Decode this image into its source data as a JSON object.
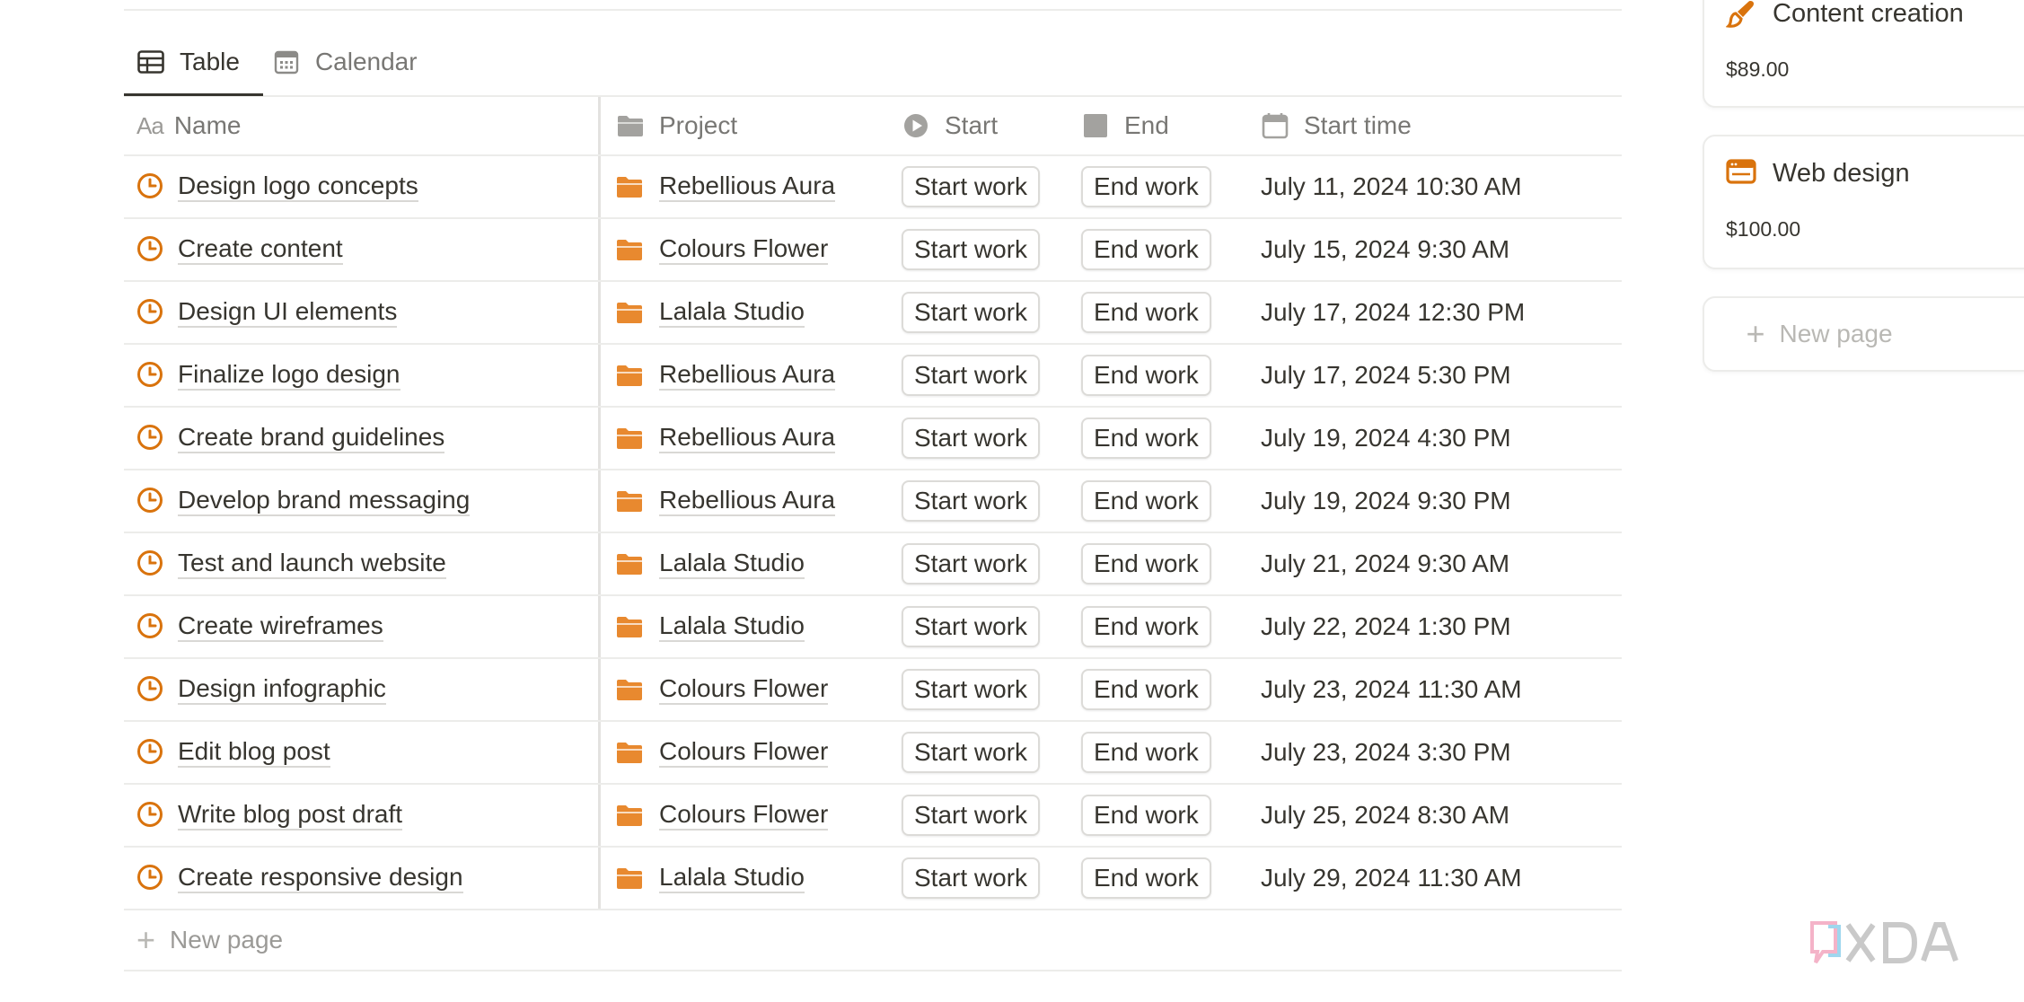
{
  "tabs": [
    {
      "label": "Table",
      "icon": "table-icon",
      "active": true
    },
    {
      "label": "Calendar",
      "icon": "calendar-icon",
      "active": false
    }
  ],
  "columns": {
    "name": {
      "label": "Name",
      "prefix": "Aa"
    },
    "project": {
      "label": "Project",
      "icon": "folder-icon"
    },
    "start": {
      "label": "Start",
      "icon": "play-circle-icon"
    },
    "end": {
      "label": "End",
      "icon": "stop-square-icon"
    },
    "start_time": {
      "label": "Start time",
      "icon": "calendar-icon"
    }
  },
  "rows": [
    {
      "name": "Design logo concepts",
      "project": "Rebellious Aura",
      "start": "Start work",
      "end": "End work",
      "start_time": "July 11, 2024 10:30 AM"
    },
    {
      "name": "Create content",
      "project": "Colours Flower",
      "start": "Start work",
      "end": "End work",
      "start_time": "July 15, 2024 9:30 AM"
    },
    {
      "name": "Design UI elements",
      "project": "Lalala Studio",
      "start": "Start work",
      "end": "End work",
      "start_time": "July 17, 2024 12:30 PM"
    },
    {
      "name": "Finalize logo design",
      "project": "Rebellious Aura",
      "start": "Start work",
      "end": "End work",
      "start_time": "July 17, 2024 5:30 PM"
    },
    {
      "name": "Create brand guidelines",
      "project": "Rebellious Aura",
      "start": "Start work",
      "end": "End work",
      "start_time": "July 19, 2024 4:30 PM"
    },
    {
      "name": "Develop brand messaging",
      "project": "Rebellious Aura",
      "start": "Start work",
      "end": "End work",
      "start_time": "July 19, 2024 9:30 PM"
    },
    {
      "name": "Test and launch website",
      "project": "Lalala Studio",
      "start": "Start work",
      "end": "End work",
      "start_time": "July 21, 2024 9:30 AM"
    },
    {
      "name": "Create wireframes",
      "project": "Lalala Studio",
      "start": "Start work",
      "end": "End work",
      "start_time": "July 22, 2024 1:30 PM"
    },
    {
      "name": "Design infographic",
      "project": "Colours Flower",
      "start": "Start work",
      "end": "End work",
      "start_time": "July 23, 2024 11:30 AM"
    },
    {
      "name": "Edit blog post",
      "project": "Colours Flower",
      "start": "Start work",
      "end": "End work",
      "start_time": "July 23, 2024 3:30 PM"
    },
    {
      "name": "Write blog post draft",
      "project": "Colours Flower",
      "start": "Start work",
      "end": "End work",
      "start_time": "July 25, 2024 8:30 AM"
    },
    {
      "name": "Create responsive design",
      "project": "Lalala Studio",
      "start": "Start work",
      "end": "End work",
      "start_time": "July 29, 2024 11:30 AM"
    }
  ],
  "table_new_page": "New page",
  "board": {
    "cards": [
      {
        "title": "Content creation",
        "price": "$89.00",
        "icon": "brush-icon"
      },
      {
        "title": "Web design",
        "price": "$100.00",
        "icon": "browser-window-icon"
      }
    ],
    "new_page": "New page"
  },
  "watermark": "XDA",
  "colors": {
    "accent_orange": "#d9730d",
    "text": "#37352f",
    "muted": "#787774",
    "border": "#ececea"
  }
}
